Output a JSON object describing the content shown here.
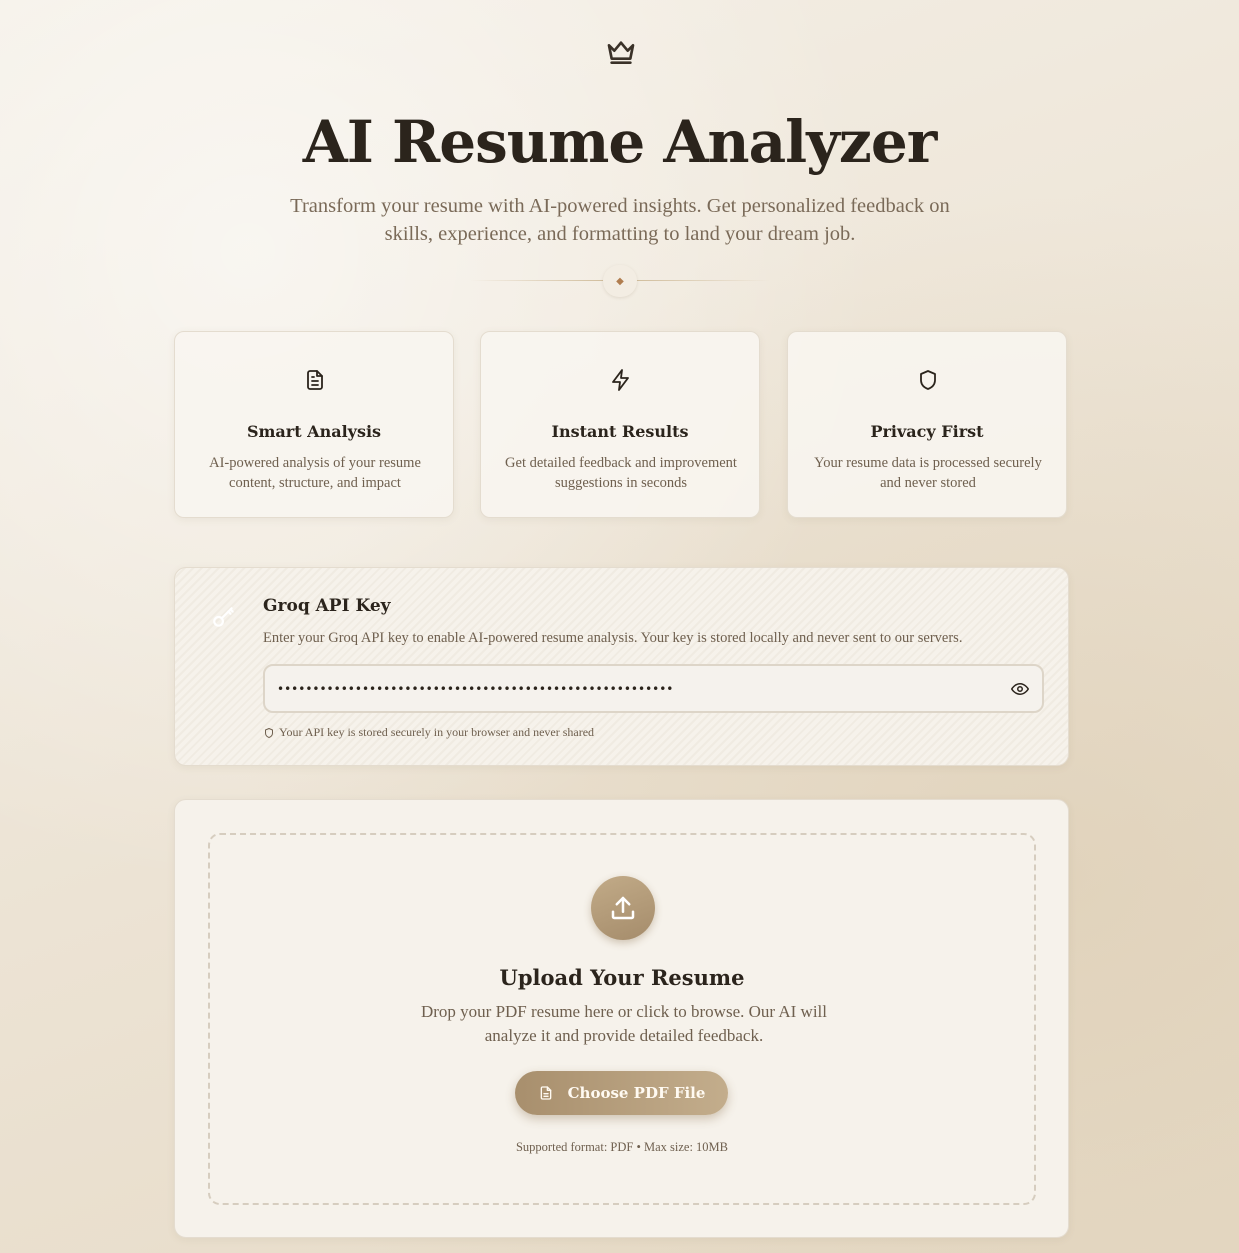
{
  "header": {
    "logo_icon": "crown-icon",
    "title": "AI Resume Analyzer",
    "subtitle": "Transform your resume with AI-powered insights. Get personalized feedback on skills, experience, and formatting to land your dream job.",
    "divider_glyph": "◆"
  },
  "features": [
    {
      "icon": "document-icon",
      "title": "Smart Analysis",
      "description": "AI-powered analysis of your resume content, structure, and impact"
    },
    {
      "icon": "lightning-icon",
      "title": "Instant Results",
      "description": "Get detailed feedback and improvement suggestions in seconds"
    },
    {
      "icon": "shield-icon",
      "title": "Privacy First",
      "description": "Your resume data is processed securely and never stored"
    }
  ],
  "api_key": {
    "icon": "key-icon",
    "title": "Groq API Key",
    "description": "Enter your Groq API key to enable AI-powered resume analysis. Your key is stored locally and never sent to our servers.",
    "value": "••••••••••••••••••••••••••••••••••••••••••••••••••••••••",
    "toggle_icon": "eye-icon",
    "note": "Your API key is stored securely in your browser and never shared"
  },
  "upload": {
    "icon": "upload-icon",
    "title": "Upload Your Resume",
    "description": "Drop your PDF resume here or click to browse. Our AI will analyze it and provide detailed feedback.",
    "button_label": "Choose PDF File",
    "note": "Supported format: PDF • Max size: 10MB"
  },
  "colors": {
    "accent": "#b09676",
    "background": "#efe8dc",
    "text": "#2b241c",
    "muted": "#6f604f"
  }
}
